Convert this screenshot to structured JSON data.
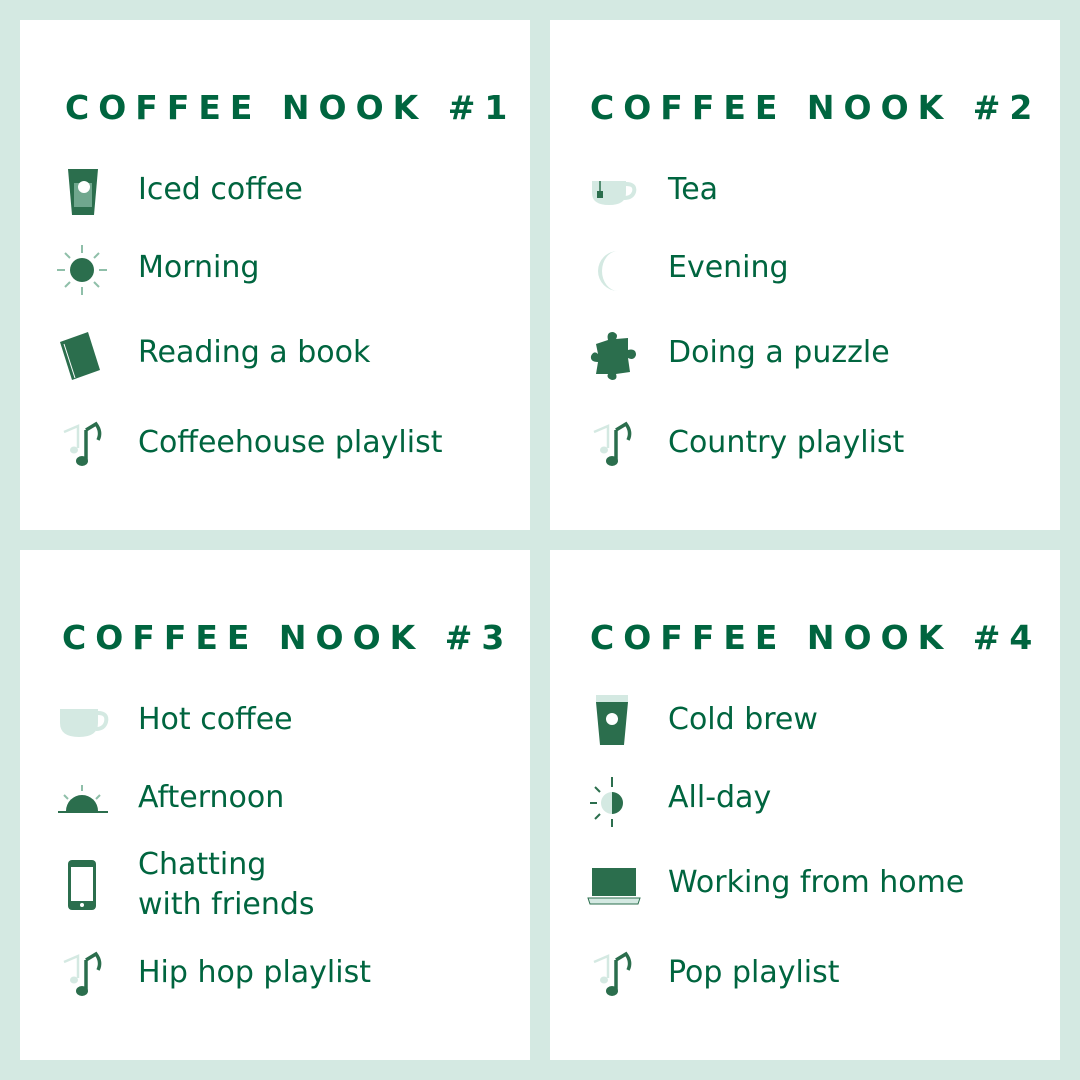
{
  "colors": {
    "background": "#d4e9e2",
    "text": "#00653f",
    "icon": "#2b6e4d",
    "icon_light": "#d4e9e2"
  },
  "nooks": [
    {
      "title": "COFFEE NOOK #1",
      "items": [
        {
          "icon": "iced-coffee-icon",
          "label": "Iced coffee"
        },
        {
          "icon": "sun-icon",
          "label": "Morning"
        },
        {
          "icon": "book-icon",
          "label": "Reading a book"
        },
        {
          "icon": "music-notes-icon",
          "label": "Coffeehouse playlist"
        }
      ]
    },
    {
      "title": "COFFEE NOOK #2",
      "items": [
        {
          "icon": "tea-cup-icon",
          "label": "Tea"
        },
        {
          "icon": "moon-icon",
          "label": "Evening"
        },
        {
          "icon": "puzzle-icon",
          "label": "Doing a puzzle"
        },
        {
          "icon": "music-notes-icon",
          "label": "Country playlist"
        }
      ]
    },
    {
      "title": "COFFEE NOOK #3",
      "items": [
        {
          "icon": "hot-coffee-cup-icon",
          "label": "Hot coffee"
        },
        {
          "icon": "sunset-icon",
          "label": "Afternoon"
        },
        {
          "icon": "phone-icon",
          "label": "Chatting\nwith friends"
        },
        {
          "icon": "music-notes-icon",
          "label": "Hip hop playlist"
        }
      ]
    },
    {
      "title": "COFFEE NOOK #4",
      "items": [
        {
          "icon": "cold-brew-icon",
          "label": "Cold brew"
        },
        {
          "icon": "half-sun-icon",
          "label": "All-day"
        },
        {
          "icon": "laptop-icon",
          "label": "Working from home"
        },
        {
          "icon": "music-notes-icon",
          "label": "Pop playlist"
        }
      ]
    }
  ]
}
